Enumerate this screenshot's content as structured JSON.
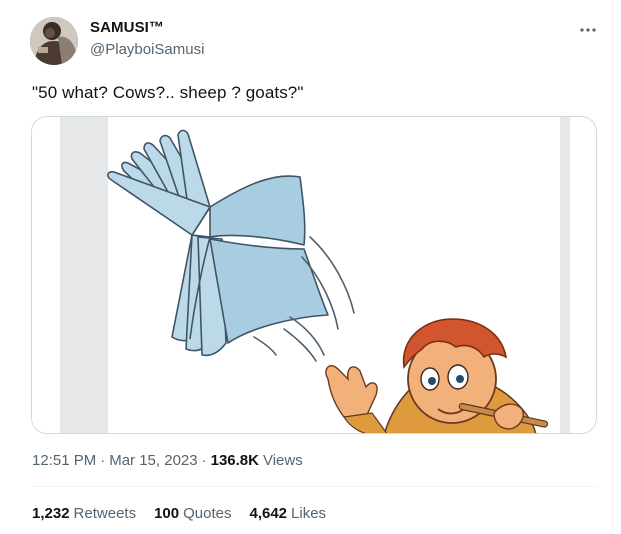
{
  "author": {
    "display_name": "SAMUSI™",
    "handle": "@PlayboiSamusi"
  },
  "tweet": {
    "text": "\"50 what? Cows?.. sheep ? goats?\""
  },
  "meta": {
    "time": "12:51 PM",
    "separator": "·",
    "date": "Mar 15, 2023",
    "views_count": "136.8K",
    "views_label": "Views"
  },
  "stats": {
    "retweets_count": "1,232",
    "retweets_label": "Retweets",
    "quotes_count": "100",
    "quotes_label": "Quotes",
    "likes_count": "4,642",
    "likes_label": "Likes"
  },
  "icons": {
    "more": "more-dots-icon"
  },
  "colors": {
    "text_primary": "#0f1419",
    "text_secondary": "#536471",
    "border": "#cfd9de",
    "book": "#a9cde0",
    "hair": "#d2562d",
    "skin": "#f2b07a"
  }
}
